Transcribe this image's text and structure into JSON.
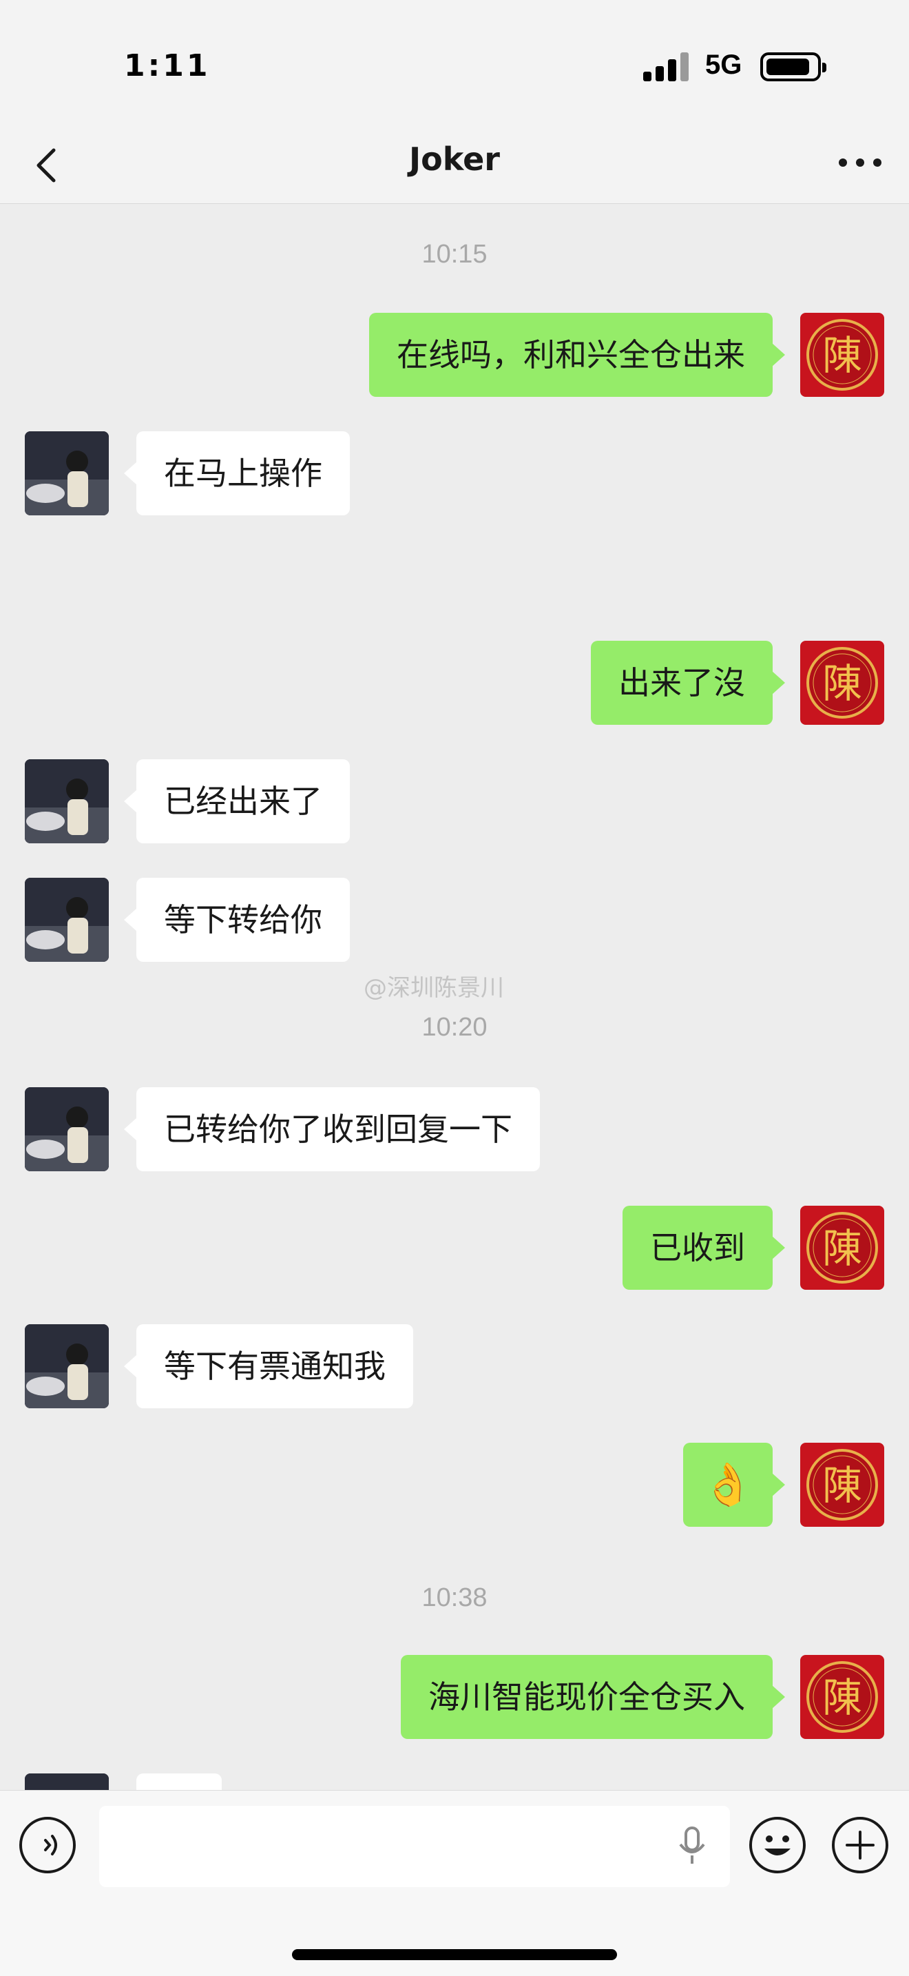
{
  "status_bar": {
    "time": "1:11",
    "network": "5G"
  },
  "header": {
    "title": "Joker",
    "back_icon": "chevron-left-icon",
    "more_icon": "more-icon"
  },
  "messages": [
    {
      "type": "timestamp",
      "text": "10:15"
    },
    {
      "type": "sent",
      "text": "在线吗，利和兴全仓出来"
    },
    {
      "type": "received",
      "text": "在马上操作"
    },
    {
      "type": "sent",
      "text": "出来了沒"
    },
    {
      "type": "received",
      "text": "已经出来了"
    },
    {
      "type": "received",
      "text": "等下转给你"
    },
    {
      "type": "timestamp",
      "text": "10:20"
    },
    {
      "type": "received",
      "text": "已转给你了收到回复一下"
    },
    {
      "type": "sent",
      "text": "已收到"
    },
    {
      "type": "received",
      "text": "等下有票通知我"
    },
    {
      "type": "sent",
      "text": "👌",
      "emoji": "ok-hand"
    },
    {
      "type": "timestamp",
      "text": "10:38"
    },
    {
      "type": "sent",
      "text": "海川智能现价全仓买入"
    }
  ],
  "watermark": "@深圳陈景川",
  "self_avatar_char": "陳",
  "colors": {
    "self_bubble": "#95ec69",
    "other_bubble": "#ffffff",
    "background": "#ededed",
    "avatar_red": "#c8141e"
  },
  "input_bar": {
    "voice_icon": "voice-icon",
    "mic_icon": "mic-icon",
    "emoji_icon": "emoji-icon",
    "plus_icon": "plus-icon",
    "value": ""
  }
}
